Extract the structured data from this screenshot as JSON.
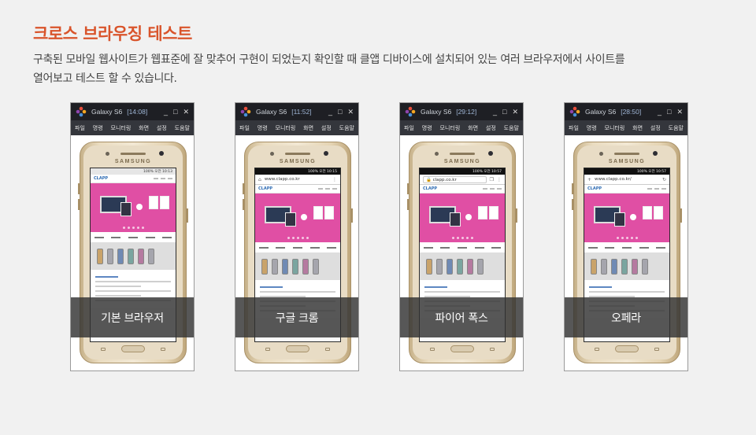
{
  "page": {
    "title": "크로스 브라우징 테스트",
    "description_line1": "구축된 모바일 웹사이트가 웹표준에 잘 맞추어 구현이 되었는지 확인할 때 클앱 디바이스에 설치되어 있는 여러 브라우저에서 사이트를",
    "description_line2": "열어보고 테스트 할 수 있습니다.",
    "title_color": "#d9542b"
  },
  "window": {
    "device_name": "Galaxy S6",
    "controls": [
      "_",
      "□",
      "✕"
    ],
    "menu": [
      "파일",
      "명령",
      "모니터링",
      "화면",
      "설정",
      "도움말"
    ],
    "phone_brand": "SAMSUNG"
  },
  "cards": [
    {
      "time": "[14:08]",
      "label": "기본 브라우저",
      "url": "",
      "status": "100% 오전 10:13",
      "browser": "default"
    },
    {
      "time": "[11:52]",
      "label": "구글 크롬",
      "url": "www.clapp.co.kr",
      "status": "100% 오전 10:15",
      "browser": "chrome"
    },
    {
      "time": "[29:12]",
      "label": "파이어 폭스",
      "url": "clapp.co.kr",
      "status": "100% 오전 10:57",
      "browser": "firefox"
    },
    {
      "time": "[28:50]",
      "label": "오페라",
      "url": "www.clapp.co.kr/",
      "status": "100% 오전 10:57",
      "browser": "opera"
    }
  ],
  "site": {
    "logo_text": "CLAPP",
    "banner_color": "#e04fa4"
  }
}
